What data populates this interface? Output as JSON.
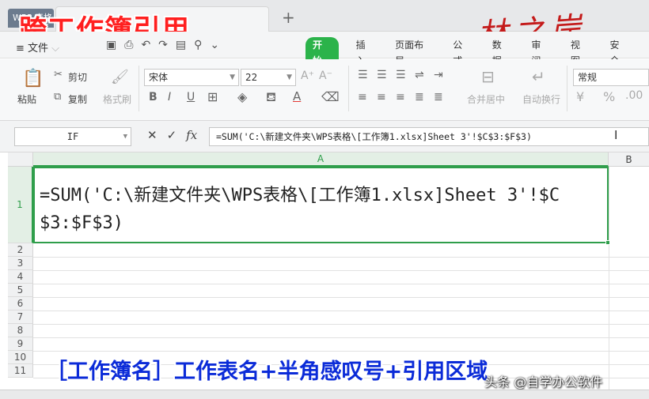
{
  "titlebar": {
    "wps_tab": "WPS 表格",
    "new_tab": "+",
    "overlay_title": "跨工作簿引用",
    "signature": "林之岸"
  },
  "menu": {
    "file": "≡ 文件",
    "items": [
      {
        "label": "开始",
        "active": true
      },
      {
        "label": "插入"
      },
      {
        "label": "页面布局"
      },
      {
        "label": "公式"
      },
      {
        "label": "数据"
      },
      {
        "label": "审阅"
      },
      {
        "label": "视图"
      },
      {
        "label": "安全"
      }
    ]
  },
  "ribbon": {
    "paste": "粘贴",
    "cut": "剪切",
    "copy": "复制",
    "format_painter": "格式刷",
    "font_name": "宋体",
    "font_size": "22",
    "merge_center": "合并居中",
    "wrap_text": "自动换行",
    "number_format": "常规",
    "percent": "%"
  },
  "formula_bar": {
    "name_box": "IF",
    "cancel": "✕",
    "confirm": "✓",
    "fx": "fx",
    "formula": "=SUM('C:\\新建文件夹\\WPS表格\\[工作簿1.xlsx]Sheet 3'!$C$3:$F$3)"
  },
  "grid": {
    "columns": [
      "A",
      "B"
    ],
    "rows": [
      "1",
      "2",
      "3",
      "4",
      "5",
      "6",
      "7",
      "8",
      "9",
      "10",
      "11"
    ],
    "cell_a1": "=SUM('C:\\新建文件夹\\WPS表格\\[工作簿1.xlsx]Sheet 3'!$C$3:$F$3)"
  },
  "caption": "［工作簿名］工作表名+半角感叹号+引用区域",
  "watermark": "头条 @自学办公软件",
  "colors": {
    "accent_green": "#2f9e4b",
    "title_red": "#ff1f1f",
    "caption_blue": "#0b2bd8"
  }
}
